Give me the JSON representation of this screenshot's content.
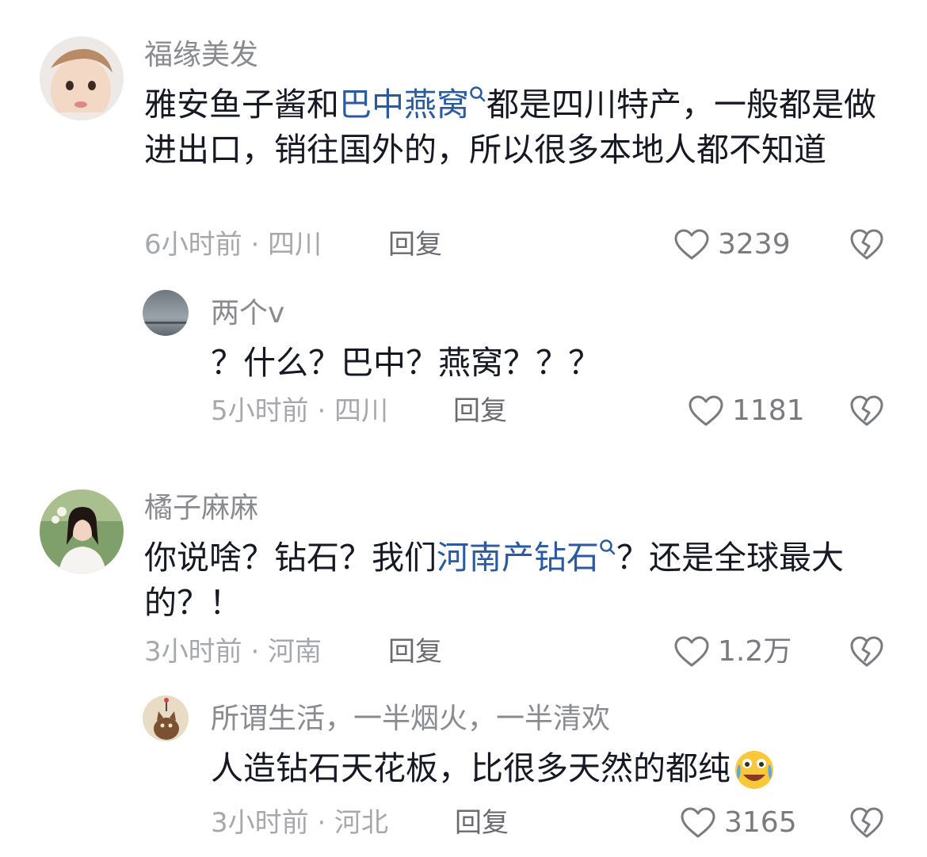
{
  "comments": [
    {
      "username": "福缘美发",
      "text_before": "雅安鱼子酱和",
      "link": "巴中燕窝",
      "text_after": "都是四川特产，一般都是做进出口，销往国外的，所以很多本地人都不知道",
      "time_location": "6小时前 · 四川",
      "reply_label": "回复",
      "likes": "3239",
      "replies": [
        {
          "username": "两个v",
          "text": "？什么？巴中？燕窝？？？",
          "time_location": "5小时前 · 四川",
          "reply_label": "回复",
          "likes": "1181"
        }
      ]
    },
    {
      "username": "橘子麻麻",
      "text_before": "你说啥？钻石？我们",
      "link": "河南产钻石",
      "text_after": "？还是全球最大的？！",
      "time_location": "3小时前 · 河南",
      "reply_label": "回复",
      "likes": "1.2万",
      "replies": [
        {
          "username": "所谓生活，一半烟火，一半清欢",
          "text": "人造钻石天花板，比很多天然的都纯",
          "emoji": "crying-laughing-emoji",
          "time_location": "3小时前 · 河北",
          "reply_label": "回复",
          "likes": "3165"
        }
      ]
    }
  ],
  "colors": {
    "link": "#2b5aa0",
    "username": "#8a8b91",
    "meta": "#a7a8ad",
    "text": "#161823"
  }
}
